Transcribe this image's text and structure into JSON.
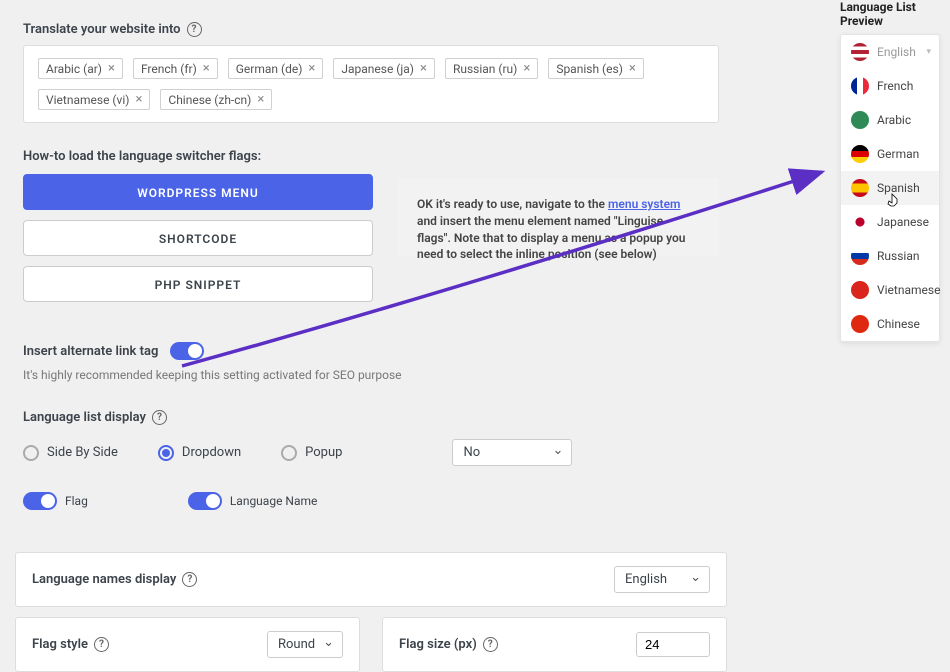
{
  "translate": {
    "label": "Translate your website into",
    "tags": [
      "Arabic (ar)",
      "French (fr)",
      "German (de)",
      "Japanese (ja)",
      "Russian (ru)",
      "Spanish (es)",
      "Vietnamese (vi)",
      "Chinese (zh-cn)"
    ]
  },
  "switcher": {
    "label": "How-to load the language switcher flags:",
    "buttons": [
      "WORDPRESS MENU",
      "SHORTCODE",
      "PHP SNIPPET"
    ],
    "info_pre": "OK it's ready to use, navigate to the ",
    "info_link": "menu system",
    "info_post": " and insert the menu element named \"Linguise flags\". Note that to display a menu as a popup you need to select the inline position (see below)"
  },
  "alternate": {
    "label": "Insert alternate link tag",
    "hint": "It's highly recommended keeping this setting activated for SEO purpose"
  },
  "display": {
    "label": "Language list display",
    "options": {
      "side": "Side By Side",
      "dropdown": "Dropdown",
      "popup": "Popup"
    },
    "select_value": "No",
    "flag_label": "Flag",
    "name_label": "Language Name"
  },
  "names": {
    "label": "Language names display",
    "value": "English"
  },
  "flag_style": {
    "label": "Flag style",
    "value": "Round"
  },
  "flag_size": {
    "label": "Flag size (px)",
    "value": "24"
  },
  "preview": {
    "title": "Language List Preview",
    "items": [
      {
        "label": "English",
        "head": true,
        "flag_css": "background: linear-gradient(#b22234 0 20%, #fff 20% 40%, #b22234 40% 60%, #fff 60% 80%, #b22234 80% 100%); position:relative;"
      },
      {
        "label": "French",
        "flag_css": "background: linear-gradient(90deg, #002395 0 33%, #fff 33% 67%, #ed2939 67% 100%);"
      },
      {
        "label": "Arabic",
        "flag_css": "background: #2e8b57;"
      },
      {
        "label": "German",
        "flag_css": "background: linear-gradient(#000 0 33%, #dd0000 33% 67%, #ffce00 67% 100%);"
      },
      {
        "label": "Spanish",
        "hover": true,
        "flag_css": "background: linear-gradient(#c60b1e 0 25%, #ffc400 25% 75%, #c60b1e 75% 100%);"
      },
      {
        "label": "Japanese",
        "flag_css": "background: radial-gradient(circle at center, #bc002d 0 35%, #fff 36% 100%);"
      },
      {
        "label": "Russian",
        "flag_css": "background: linear-gradient(#fff 0 33%, #0039a6 33% 67%, #d52b1e 67% 100%);"
      },
      {
        "label": "Vietnamese",
        "flag_css": "background: #da251d;"
      },
      {
        "label": "Chinese",
        "flag_css": "background: #de2910;"
      }
    ]
  }
}
